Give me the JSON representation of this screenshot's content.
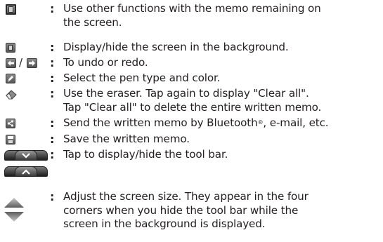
{
  "colon": ":",
  "items": [
    {
      "icon": "window-split-icon",
      "lines": [
        "Use other functions with the memo remaining on",
        "the screen."
      ]
    },
    {
      "icon": "background-screen-icon",
      "lines": [
        "Display/hide the screen in the background."
      ]
    },
    {
      "icon": "undo-redo-icon",
      "separator": "/",
      "lines": [
        "To undo or redo."
      ]
    },
    {
      "icon": "pen-icon",
      "lines": [
        "Select the pen type and color."
      ]
    },
    {
      "icon": "eraser-icon",
      "lines": [
        "Use the eraser. Tap again to display \"Clear all\".",
        "Tap \"Clear all\" to delete the entire written memo."
      ]
    },
    {
      "icon": "share-icon",
      "text_before": "Send the written memo by Bluetooth",
      "registered": "®",
      "text_after": ", e-mail, etc."
    },
    {
      "icon": "save-icon",
      "lines": [
        "Save the written memo."
      ]
    },
    {
      "icon": "toolbar-toggle-icon",
      "lines": [
        "Tap to display/hide the tool bar."
      ]
    },
    {
      "icon": "resize-corner-icon",
      "lines": [
        "Adjust the screen size. They appear in the four",
        "corners when you hide the tool bar while the",
        "screen in the background is displayed."
      ]
    }
  ],
  "colors": {
    "text": "#231f20",
    "icon_gray": "#6e6e6e"
  }
}
